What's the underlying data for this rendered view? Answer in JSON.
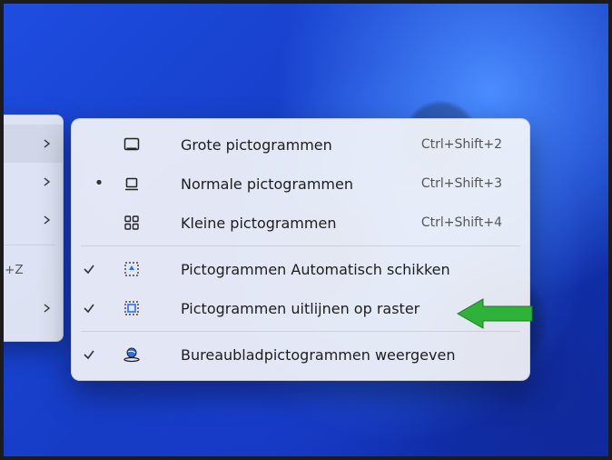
{
  "parent_menu": {
    "ctrl_z": "Ctrl+Z"
  },
  "submenu": {
    "large_icons": {
      "label": "Grote pictogrammen",
      "shortcut": "Ctrl+Shift+2"
    },
    "medium_icons": {
      "label": "Normale pictogrammen",
      "shortcut": "Ctrl+Shift+3"
    },
    "small_icons": {
      "label": "Kleine pictogrammen",
      "shortcut": "Ctrl+Shift+4"
    },
    "auto_arrange": {
      "label": "Pictogrammen Automatisch schikken"
    },
    "align_grid": {
      "label": "Pictogrammen uitlijnen op raster"
    },
    "show_desktop_icons": {
      "label": "Bureaubladpictogrammen weergeven"
    }
  }
}
